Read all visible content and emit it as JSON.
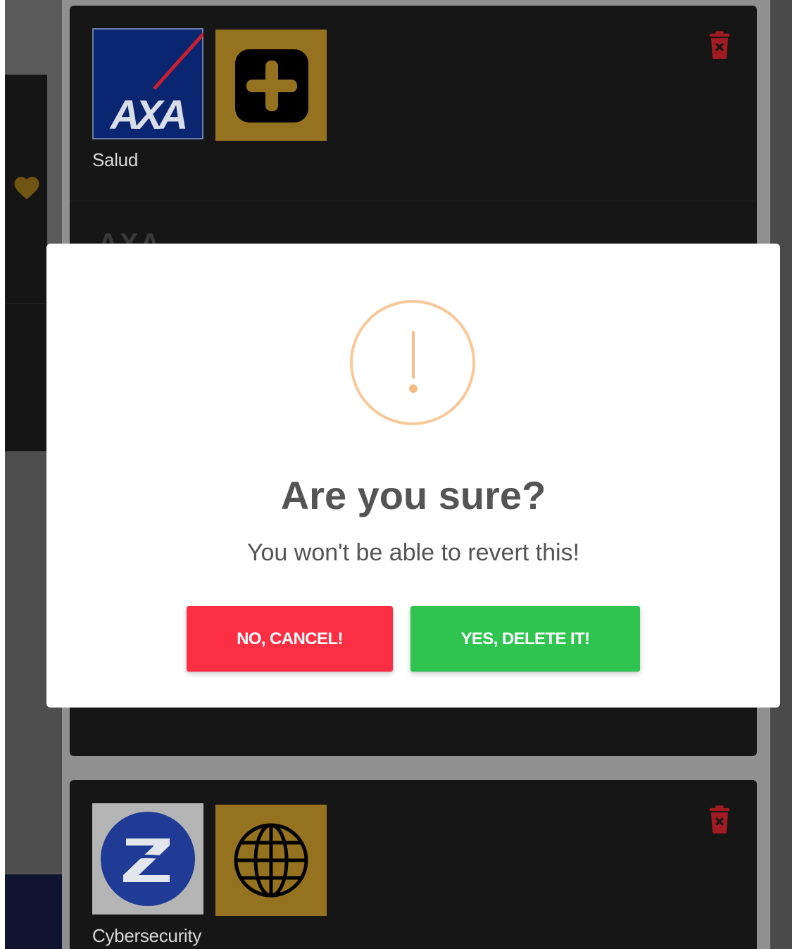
{
  "colors": {
    "card_bg": "#161616",
    "gold": "#957220",
    "trash": "#a11c22",
    "cancel": "#fc2e43",
    "confirm": "#2fc450",
    "warning": "#f8c898",
    "axa_blue": "#0b2670",
    "zurich_blue": "#1f3b95"
  },
  "background": {
    "favorite_icon": "heart-icon",
    "cards": [
      {
        "insurer_logo": "axa-logo",
        "logo_text": "AXA",
        "category_icon": "plus-icon",
        "category": "Salud",
        "delete_icon": "trash-icon",
        "obscured_text": "AXA"
      },
      {
        "insurer_logo": "zurich-logo",
        "category_icon": "globe-icon",
        "category": "Cybersecurity",
        "delete_icon": "trash-icon"
      }
    ]
  },
  "modal": {
    "icon": "warning-icon",
    "title": "Are you sure?",
    "text": "You won't be able to revert this!",
    "cancel_label": "NO, CANCEL!",
    "confirm_label": "YES, DELETE IT!"
  }
}
